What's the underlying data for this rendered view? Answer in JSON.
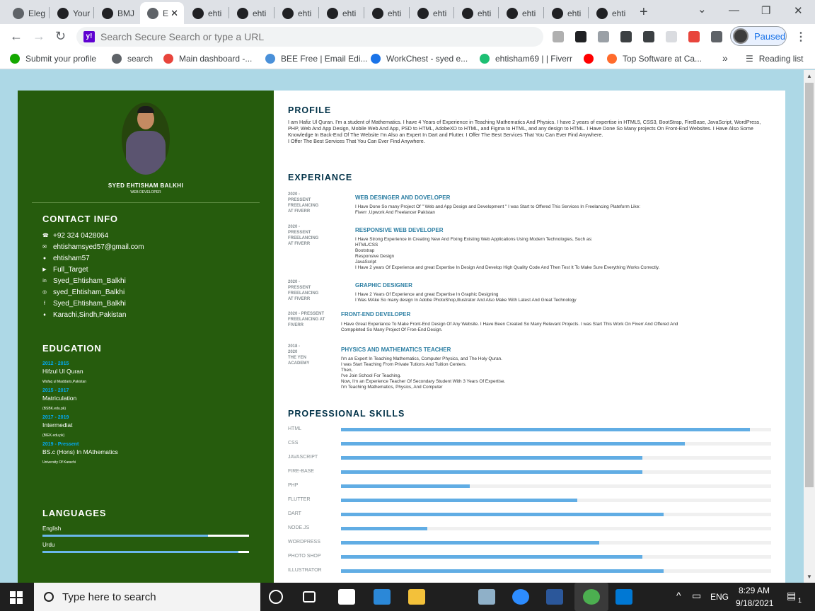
{
  "browser": {
    "tabs": [
      {
        "label": "Eleg",
        "icon": "globe-icon"
      },
      {
        "label": "Your",
        "icon": "github-icon"
      },
      {
        "label": "BMJ",
        "icon": "github-icon"
      },
      {
        "label": "E",
        "icon": "globe-icon",
        "active": true
      },
      {
        "label": "ehti",
        "icon": "github-icon"
      },
      {
        "label": "ehti",
        "icon": "github-icon"
      },
      {
        "label": "ehti",
        "icon": "github-icon"
      },
      {
        "label": "ehti",
        "icon": "github-icon"
      },
      {
        "label": "ehti",
        "icon": "github-icon"
      },
      {
        "label": "ehti",
        "icon": "github-icon"
      },
      {
        "label": "ehti",
        "icon": "github-icon"
      },
      {
        "label": "ehti",
        "icon": "github-icon"
      },
      {
        "label": "ehti",
        "icon": "github-icon"
      },
      {
        "label": "ehti",
        "icon": "github-icon"
      }
    ],
    "close_glyph": "✕",
    "new_tab": "+",
    "omnibox_placeholder": "Search Secure Search or type a URL",
    "profile_status": "Paused",
    "bookmarks": [
      {
        "label": "Submit your profile",
        "color": "#14a800"
      },
      {
        "label": "search",
        "color": "#5f6368"
      },
      {
        "label": "Main dashboard -...",
        "color": "#e8453c"
      },
      {
        "label": "BEE Free | Email Edi...",
        "color": "#4a90d9"
      },
      {
        "label": "WorkChest - syed e...",
        "color": "#1a73e8"
      },
      {
        "label": "ehtisham69 | | Fiverr",
        "color": "#1dbf73"
      },
      {
        "label": "",
        "color": "#ff0000"
      },
      {
        "label": "Top Software at Ca...",
        "color": "#ff6b2c"
      }
    ],
    "more_bookmarks": "»",
    "reading_list": "Reading list"
  },
  "resume": {
    "name": "SYED EHTISHAM BALKHI",
    "role": "WEB DEVELOPER",
    "contact_title": "CONTACT INFO",
    "contact": [
      {
        "icon": "phone-icon",
        "glyph": "☎",
        "text": "+92 324 0428064"
      },
      {
        "icon": "email-icon",
        "glyph": "✉",
        "text": "ehtishamsyed57@gmail.com"
      },
      {
        "icon": "github-icon",
        "glyph": "●",
        "text": "ehtisham57"
      },
      {
        "icon": "youtube-icon",
        "glyph": "▶",
        "text": "Full_Target"
      },
      {
        "icon": "linkedin-icon",
        "glyph": "in",
        "text": "Syed_Ehtisham_Balkhi"
      },
      {
        "icon": "instagram-icon",
        "glyph": "◎",
        "text": "syed_Ehtisham_Balkhi"
      },
      {
        "icon": "facebook-icon",
        "glyph": "f",
        "text": "Syed_Ehtisham_Balkhi"
      },
      {
        "icon": "location-icon",
        "glyph": "♦",
        "text": "Karachi,Sindh,Pakistan"
      }
    ],
    "education_title": "EDUCATION",
    "education": [
      {
        "years": "2012 - 2015",
        "title": "Hifzul Ul Quran",
        "place": "Wafaq ul Maddaris,Pakistan"
      },
      {
        "years": "2015 - 2017",
        "title": "Matriculation",
        "place": "(BSBK.edu.pk)"
      },
      {
        "years": "2017 - 2019",
        "title": "Intermediat",
        "place": "(BIEK.edu.pk)"
      },
      {
        "years": "2019 - Pressent",
        "title": "BS.c (Hons) In MAthematics",
        "place": "University Of Karachi"
      }
    ],
    "languages_title": "LANGUAGES",
    "languages": [
      {
        "name": "English",
        "level": 0.8
      },
      {
        "name": "Urdu",
        "level": 0.95
      }
    ],
    "profile_title": "PROFILE",
    "profile_text": "I am Hafiz Ul Quran. I'm a student of Mathematics. I have 4 Years of Experience in Teaching Mathematics And Physics. I have 2 years of expertise in HTML5, CSS3, BootStrap, FireBase, JavaScript, WordPress, PHP, Web And App Design, Mobile Web And App, PSD to HTML, AdobeXD to HTML, and Figma to HTML, and any design to HTML. I Have Done So Many projects On Front-End Websites. I Have Also Some Knowledge In Back-End Of The Website I'm Also an Expert In Dart and Flutter. I Offer The Best Services That You Can Ever Find Anywhere.",
    "profile_text2": "I Offer The Best Services That You Can Ever Find Anywhere.",
    "experience_title": "EXPERIANCE",
    "experience": [
      {
        "date": "2020 - PRESSENT",
        "org": "FREELANCING AT FIVERR",
        "title": "WEB DESINGER AND DOVELOPER",
        "lines": [
          "I Have Done So many Project Of \" Web and App Design and Development \" I was Start to Offered This Services In Freelancing Plateform Like:",
          "Fiverr ,Upwork And Freelancer Pakistan"
        ]
      },
      {
        "date": "2020 - PRESSENT",
        "org": "FREELANCING AT FIVERR",
        "title": "RESPONSIVE WEB DEVELOPER",
        "lines": [
          "I Have Strong Experience in Creating New And Fixing Existing Web Applications Using Modern Technologies, Such as:",
          "HTML/CSS",
          "Bootstrap",
          "Responsive Design",
          "JavaScript",
          "I Have 2 years Of Experience and great Expertise In Design And Develop High Quality Code And Then Test It To Make Sure Everything Works Correctly."
        ]
      },
      {
        "date": "2020 - PRESSENT",
        "org": "FREELANCING AT FIVERR",
        "title": "GRAPHIC DESIGNER",
        "lines": [
          "I Have 2 Years Of Experience and great Expertise In Graphic Designing",
          "I Was MAke So many design In Adobe PhotoShop,Illustrator And Also Make With Latest And Great Technology"
        ]
      },
      {
        "date": "2020 - PRESSENT",
        "org": "FREELANCING AT FIVERR",
        "title": "FRONT-END DEVELOPER",
        "lines": [
          "I Have Great Experiance To Make Front-End Design Of Any Website. I Have Been Created So Many Relevant Projects. I was Start This Work On Fiverr And Offered And",
          "Comppleted So Many Project Of Fron-End Design."
        ]
      },
      {
        "date": "2018 - 2020",
        "org": "THE YEN ACADEMY",
        "title": "PHYSICS AND MATHEMATICS TEACHER",
        "lines": [
          "I'm an Expert In Teaching Mathematics, Computer Physics, and The Holy Quran.",
          "I was Start Teaching From Private Tutions And Tuition Centers.",
          "Then,",
          "I've Join School For Teaching.",
          "Now, I'm an Experience Teacher Of Secondary Student With 3 Years Of Expertise.",
          "I'm Teaching Mathematics, Physics, And Computer"
        ]
      }
    ],
    "skills_title": "PROFESSIONAL SKILLS",
    "skills": [
      {
        "name": "HTML",
        "level": 0.95
      },
      {
        "name": "CSS",
        "level": 0.8
      },
      {
        "name": "JAVASCRIPT",
        "level": 0.7
      },
      {
        "name": "FIRE-BASE",
        "level": 0.7
      },
      {
        "name": "PHP",
        "level": 0.3
      },
      {
        "name": "FLUTTER",
        "level": 0.55
      },
      {
        "name": "DART",
        "level": 0.75
      },
      {
        "name": "NODE.JS",
        "level": 0.2
      },
      {
        "name": "WORDPRESS",
        "level": 0.6
      },
      {
        "name": "PHOTO SHOP",
        "level": 0.7
      },
      {
        "name": "ILLUSTRATOR",
        "level": 0.75
      }
    ]
  },
  "taskbar": {
    "search_placeholder": "Type here to search",
    "language": "ENG",
    "time": "8:29 AM",
    "date": "9/18/2021",
    "notifications": "1"
  }
}
